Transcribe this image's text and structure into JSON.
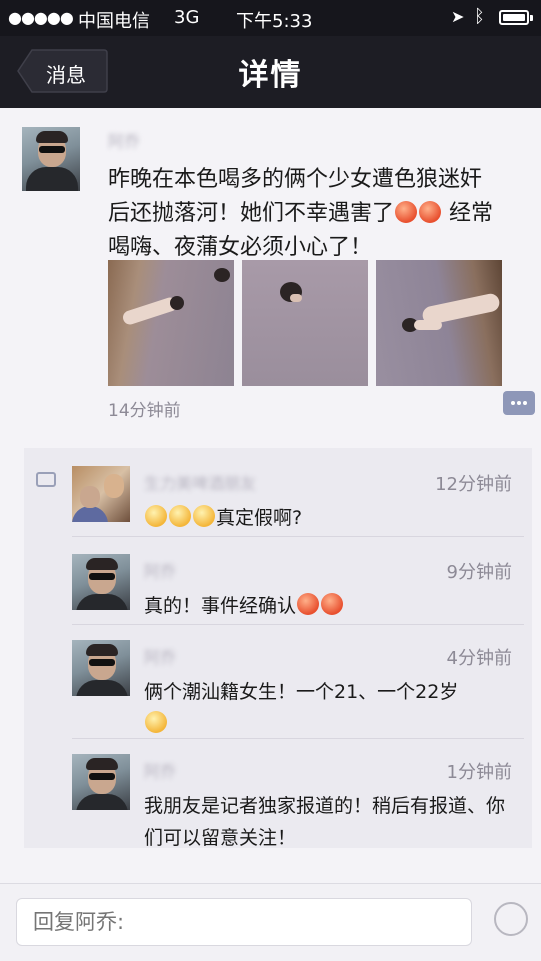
{
  "status_bar": {
    "signal": "●●●●●",
    "carrier": "中国电信",
    "network": "3G",
    "time": "下午5:33"
  },
  "nav": {
    "back_label": "消息",
    "title": "详情"
  },
  "post": {
    "author": "阿乔",
    "text_line1": "昨晚在本色喝多的俩个少女遭色狼迷奸",
    "text_line2a": "后还抛落河！她们不幸遇害了",
    "text_line2b": "经常",
    "text_line3": "喝嗨、夜蒲女必须小心了！",
    "time": "14分钟前"
  },
  "comments": [
    {
      "author": "生力美啤酒朋友",
      "time": "12分钟前",
      "text": "真定假啊?"
    },
    {
      "author": "阿乔",
      "time": "9分钟前",
      "text": "真的！事件经确认"
    },
    {
      "author": "阿乔",
      "time": "4分钟前",
      "text": "俩个潮汕籍女生！一个21、一个22岁"
    },
    {
      "author": "阿乔",
      "time": "1分钟前",
      "text": "我朋友是记者独家报道的！稍后有报道、你们可以留意关注！"
    }
  ],
  "reply": {
    "placeholder": "回复阿乔:"
  }
}
